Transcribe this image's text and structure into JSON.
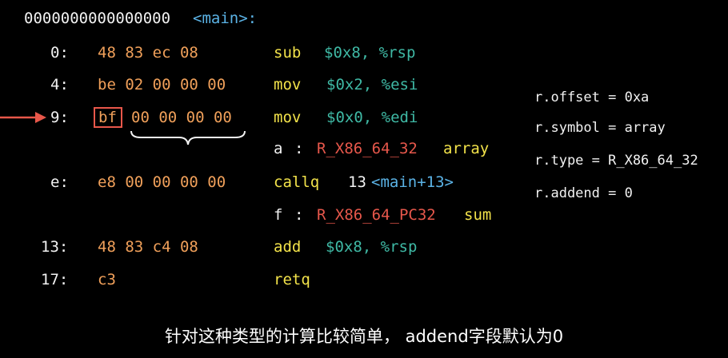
{
  "header": {
    "address": "0000000000000000",
    "symbol": "<main>:"
  },
  "rows": [
    {
      "offset": "0:",
      "bytes": "48 83 ec 08",
      "mnemonic": "sub",
      "operands": "$0x8, %rsp"
    },
    {
      "offset": "4:",
      "bytes": "be 02 00 00 00",
      "mnemonic": "mov",
      "operands": "$0x2, %esi"
    },
    {
      "offset": "9:",
      "bytes_first": "bf",
      "bytes_rest": "00 00 00 00",
      "mnemonic": "mov",
      "operands": "$0x0, %edi"
    },
    {
      "reloc_offset": "a",
      "reloc_sep": ":",
      "reloc_type": "R_X86_64_32",
      "reloc_symbol": "array"
    },
    {
      "offset": "e:",
      "bytes": "e8 00 00 00 00",
      "mnemonic": "callq",
      "target_addr": "13",
      "target_symbol": "<main+13>"
    },
    {
      "reloc_offset": "f",
      "reloc_sep": ":",
      "reloc_type": "R_X86_64_PC32",
      "reloc_symbol": "sum"
    },
    {
      "offset": "13:",
      "bytes": "48 83 c4 08",
      "mnemonic": "add",
      "operands": "$0x8, %rsp"
    },
    {
      "offset": "17:",
      "bytes": "c3",
      "mnemonic": "retq"
    }
  ],
  "relocation_entry": [
    "r.offset = 0xa",
    "r.symbol = array",
    "r.type = R_X86_64_32",
    "r.addend = 0"
  ],
  "subtitle": "针对这种类型的计算比较简单， addend字段默认为0",
  "colors": {
    "background": "#000000",
    "offset": "#f2f2f2",
    "bytes": "#f0a05a",
    "mnemonic": "#f2e24a",
    "operand": "#3fb9a5",
    "relocation_type": "#e6574b",
    "symbol_ref": "#5bb3e6",
    "highlight": "#e8574a"
  }
}
